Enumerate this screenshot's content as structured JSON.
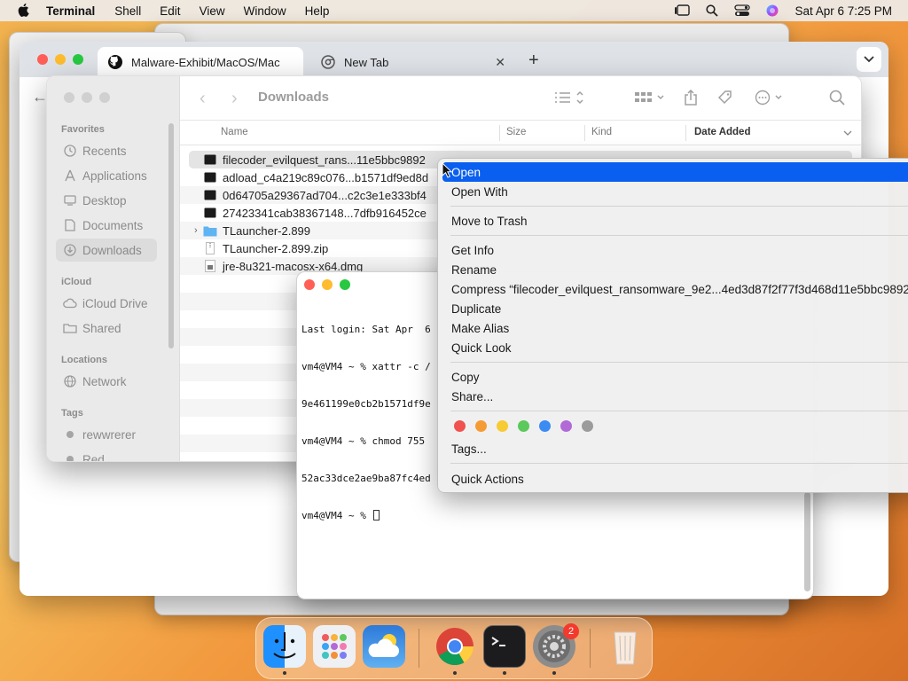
{
  "menubar": {
    "app_name": "Terminal",
    "items": [
      "Shell",
      "Edit",
      "View",
      "Window",
      "Help"
    ],
    "clock": "Sat Apr 6  7:25 PM"
  },
  "chrome": {
    "tabs": [
      {
        "label": "Malware-Exhibit/MacOS/Mac",
        "active": true
      },
      {
        "label": "New Tab",
        "active": false
      }
    ]
  },
  "finder": {
    "title": "Downloads",
    "sidebar": {
      "favorites_label": "Favorites",
      "favorites": [
        "Recents",
        "Applications",
        "Desktop",
        "Documents",
        "Downloads"
      ],
      "icloud_label": "iCloud",
      "icloud": [
        "iCloud Drive",
        "Shared"
      ],
      "locations_label": "Locations",
      "locations": [
        "Network"
      ],
      "tags_label": "Tags",
      "tags": [
        "rewwrerer",
        "Red"
      ]
    },
    "columns": {
      "name": "Name",
      "size": "Size",
      "kind": "Kind",
      "date_added": "Date Added"
    },
    "files": [
      "filecoder_evilquest_rans...11e5bbc9892",
      "adload_c4a219c89c076...b1571df9ed8d",
      "0d64705a29367ad704...c2c3e1e333bf4",
      "27423341cab38367148...7dfb916452ce",
      "TLauncher-2.899",
      "TLauncher-2.899.zip",
      "jre-8u321-macosx-x64.dmg"
    ]
  },
  "terminal": {
    "lines": [
      "Last login: Sat Apr  6",
      "vm4@VM4 ~ % xattr -c /",
      "9e461199e0cb2b1571df9e",
      "vm4@VM4 ~ % chmod 755 ",
      "52ac33dce2ae9ba87fc4ed",
      "vm4@VM4 ~ % "
    ]
  },
  "context_menu": {
    "open": "Open",
    "open_with": "Open With",
    "move_to_trash": "Move to Trash",
    "get_info": "Get Info",
    "rename": "Rename",
    "compress": "Compress “filecoder_evilquest_ransomware_9e2...4ed3d87f2f77f3d468d11e5bbc9892",
    "duplicate": "Duplicate",
    "make_alias": "Make Alias",
    "quick_look": "Quick Look",
    "copy": "Copy",
    "share": "Share...",
    "tags": "Tags...",
    "quick_actions": "Quick Actions",
    "tag_colors": [
      "#f0524f",
      "#f59b36",
      "#f7cb33",
      "#5bc95b",
      "#3a8bf2",
      "#b26ad6",
      "#9b9b9b"
    ]
  },
  "dock": {
    "settings_badge": "2"
  }
}
